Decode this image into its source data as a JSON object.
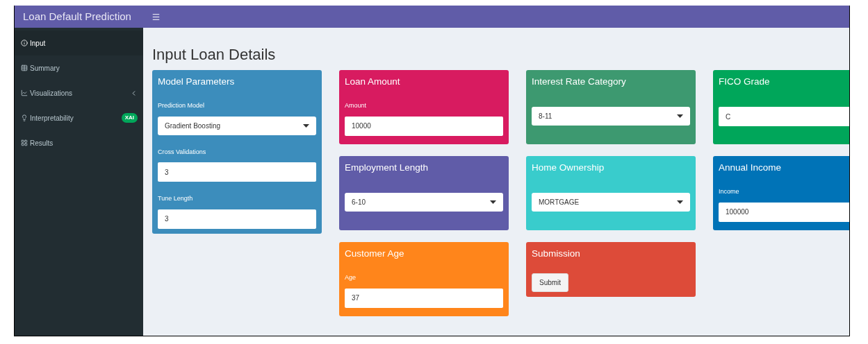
{
  "header": {
    "title": "Loan Default Prediction"
  },
  "sidebar": {
    "items": [
      {
        "label": "Input",
        "selected": true
      },
      {
        "label": "Summary",
        "selected": false
      },
      {
        "label": "Visualizations",
        "selected": false,
        "submenu": true
      },
      {
        "label": "Interpretability",
        "selected": false,
        "badge": "XAI"
      },
      {
        "label": "Results",
        "selected": false
      }
    ]
  },
  "page_title": "Input Loan Details",
  "columns": [
    [
      {
        "title": "Model Parameters",
        "color": "#3c8dbc",
        "fields": [
          {
            "kind": "select",
            "label": "Prediction Model",
            "value": "Gradient Boosting"
          },
          {
            "kind": "text",
            "label": "Cross Validations",
            "value": "3"
          },
          {
            "kind": "text",
            "label": "Tune Length",
            "value": "3"
          }
        ]
      }
    ],
    [
      {
        "title": "Loan Amount",
        "color": "#d81b60",
        "fields": [
          {
            "kind": "text",
            "label": "Amount",
            "value": "10000"
          }
        ]
      },
      {
        "title": "Employment Length",
        "color": "#605ca8",
        "fields": [
          {
            "kind": "select",
            "value": "6-10"
          }
        ]
      },
      {
        "title": "Customer Age",
        "color": "#ff851b",
        "fields": [
          {
            "kind": "text",
            "label": "Age",
            "value": "37"
          }
        ]
      }
    ],
    [
      {
        "title": "Interest Rate Category",
        "color": "#3d9970",
        "fields": [
          {
            "kind": "select",
            "value": "8-11"
          }
        ]
      },
      {
        "title": "Home Ownership",
        "color": "#39cccc",
        "fields": [
          {
            "kind": "select",
            "value": "MORTGAGE"
          }
        ]
      },
      {
        "title": "Submission",
        "color": "#dd4b39",
        "fields": [
          {
            "kind": "button",
            "value": "Submit"
          }
        ]
      }
    ],
    [
      {
        "title": "FICO Grade",
        "color": "#00a65a",
        "fields": [
          {
            "kind": "text",
            "value": "C"
          }
        ]
      },
      {
        "title": "Annual Income",
        "color": "#0073b7",
        "fields": [
          {
            "kind": "text",
            "label": "Income",
            "value": "100000"
          }
        ]
      }
    ]
  ]
}
